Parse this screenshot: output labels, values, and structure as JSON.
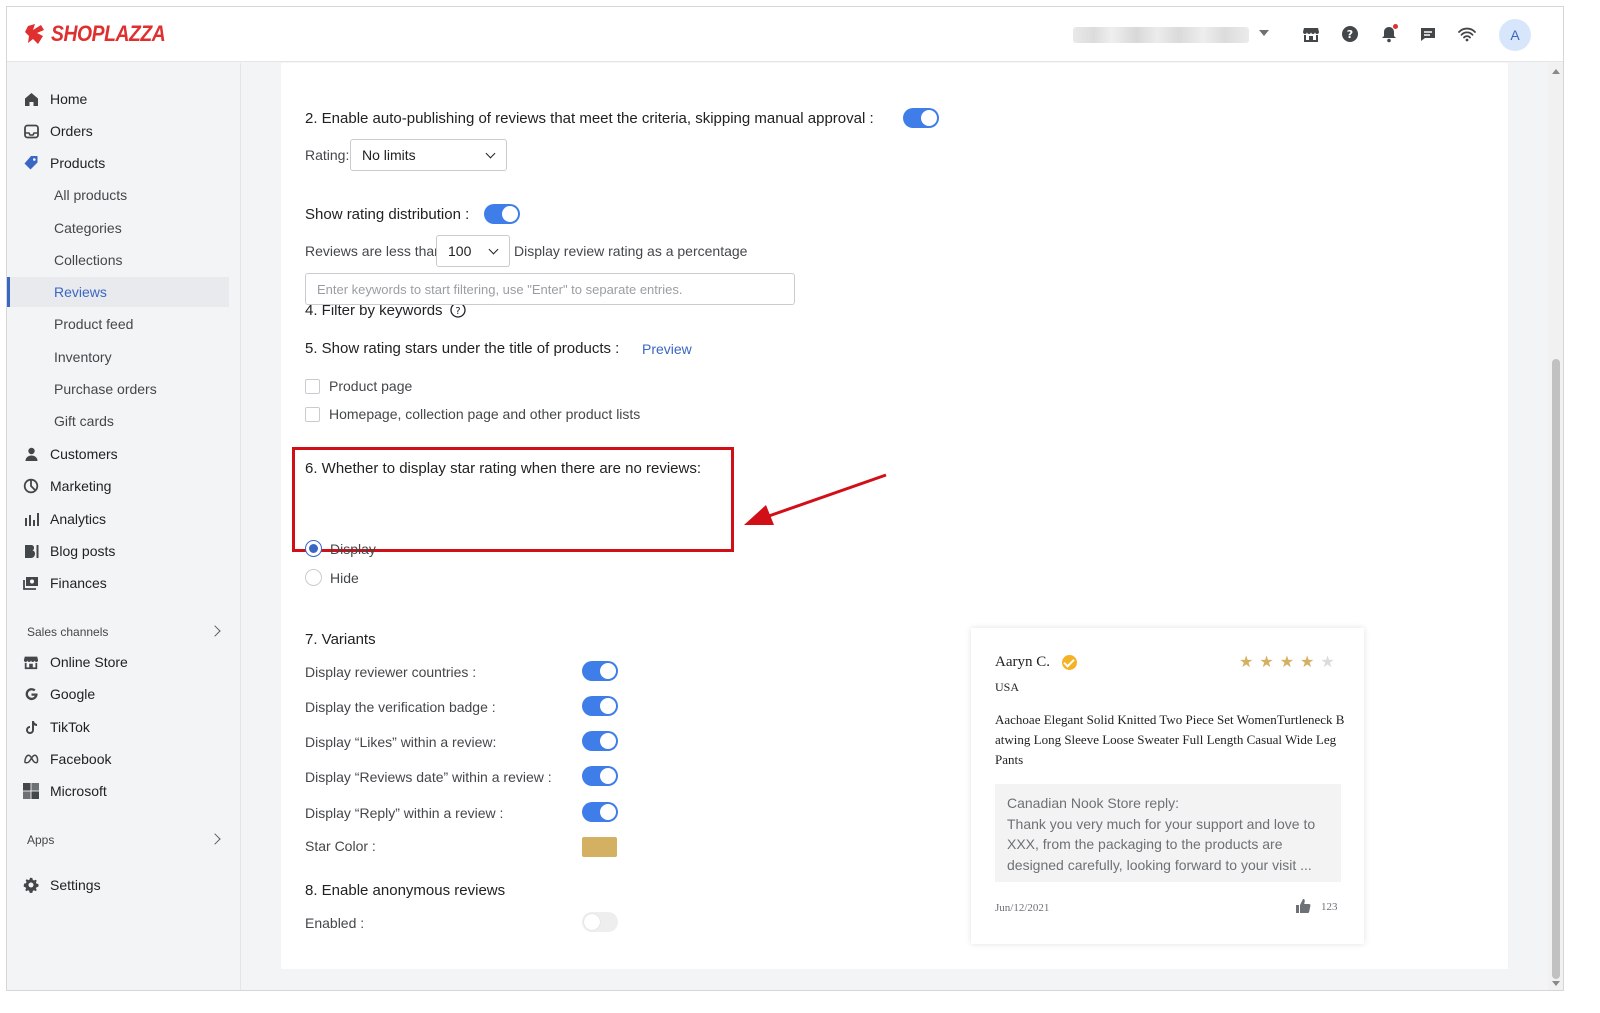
{
  "brand": {
    "logo_text": "SHOPLAZZA",
    "accent": "#e02f2f"
  },
  "topbar": {
    "icons": [
      "store-icon",
      "help-icon",
      "bell-icon",
      "chat-icon",
      "wifi-icon"
    ],
    "avatar_initial": "A"
  },
  "sidebar": {
    "items": [
      {
        "label": "Home",
        "icon": "home-icon"
      },
      {
        "label": "Orders",
        "icon": "orders-icon"
      },
      {
        "label": "Products",
        "icon": "tag-icon"
      },
      {
        "label": "All products"
      },
      {
        "label": "Categories"
      },
      {
        "label": "Collections"
      },
      {
        "label": "Reviews",
        "active": true
      },
      {
        "label": "Product feed"
      },
      {
        "label": "Inventory"
      },
      {
        "label": "Purchase orders"
      },
      {
        "label": "Gift cards"
      },
      {
        "label": "Customers",
        "icon": "person-icon"
      },
      {
        "label": "Marketing",
        "icon": "marketing-icon"
      },
      {
        "label": "Analytics",
        "icon": "analytics-icon"
      },
      {
        "label": "Blog posts",
        "icon": "blog-icon"
      },
      {
        "label": "Finances",
        "icon": "finances-icon"
      }
    ],
    "sales_channels_label": "Sales channels",
    "channels": [
      {
        "label": "Online Store",
        "icon": "store-icon"
      },
      {
        "label": "Google",
        "icon": "google-icon"
      },
      {
        "label": "TikTok",
        "icon": "tiktok-icon"
      },
      {
        "label": "Facebook",
        "icon": "meta-icon"
      },
      {
        "label": "Microsoft",
        "icon": "microsoft-icon"
      }
    ],
    "apps_label": "Apps",
    "settings_label": "Settings"
  },
  "settings": {
    "auto_publish": {
      "label": "2. Enable auto-publishing of reviews that meet the criteria, skipping manual approval :",
      "enabled": true,
      "rating_label": "Rating:",
      "rating_value": "No limits"
    },
    "rating_distribution": {
      "label": "Show rating distribution :",
      "enabled": true,
      "prefix": "Reviews are less than",
      "value": "100",
      "suffix": "Display review rating as a percentage"
    },
    "keywords": {
      "label": "4. Filter by keywords",
      "placeholder": "Enter keywords to start filtering, use \"Enter\" to separate entries."
    },
    "stars_under_title": {
      "label": "5. Show rating stars under the title of products :",
      "preview_link": "Preview",
      "options": [
        "Product page",
        "Homepage, collection page and other product lists"
      ]
    },
    "no_reviews": {
      "label": "6. Whether to display star rating when there are no reviews:",
      "options": [
        "Display",
        "Hide"
      ],
      "selected": "Display"
    },
    "variants": {
      "label": "7. Variants",
      "rows": [
        {
          "label": "Display reviewer countries :",
          "enabled": true
        },
        {
          "label": "Display the verification badge :",
          "enabled": true
        },
        {
          "label": "Display “Likes” within a review:",
          "enabled": true
        },
        {
          "label": "Display “Reviews date” within a review :",
          "enabled": true
        },
        {
          "label": "Display “Reply” within a review :",
          "enabled": true
        }
      ],
      "star_color_label": "Star Color :",
      "star_color": "#d4b062"
    },
    "anonymous": {
      "label": "8. Enable anonymous reviews",
      "enabled_label": "Enabled :",
      "enabled": false
    }
  },
  "preview": {
    "name": "Aaryn C.",
    "country": "USA",
    "stars_filled": 4,
    "stars_total": 5,
    "content": "Aachoae Elegant Solid Knitted Two Piece Set WomenTurtleneck Batwing Long Sleeve Loose Sweater Full  Length Casual Wide Leg Pants",
    "reply_title": "Canadian Nook Store reply:",
    "reply_text": "Thank you very much for your support and love to XXX, from the packaging to the products are designed carefully, looking forward to your visit ...",
    "date": "Jun/12/2021",
    "likes": "123"
  }
}
